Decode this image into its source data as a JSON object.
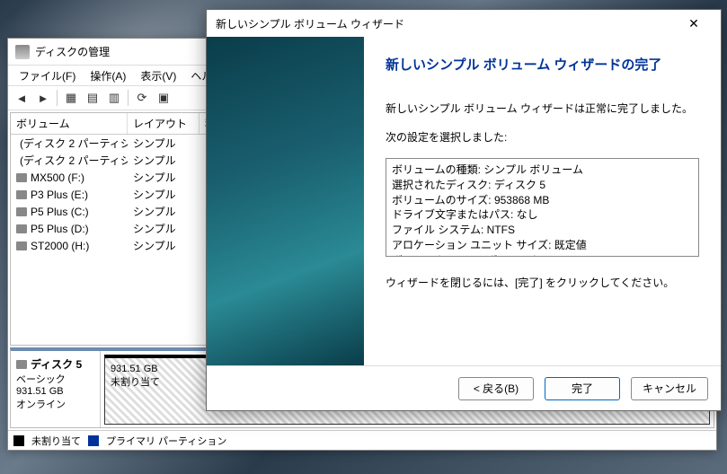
{
  "dm": {
    "title": "ディスクの管理",
    "menu": {
      "file": "ファイル(F)",
      "action": "操作(A)",
      "view": "表示(V)",
      "help": "ヘルプ"
    },
    "headers": {
      "volume": "ボリューム",
      "layout": "レイアウト",
      "rest": "種"
    },
    "volumes": [
      {
        "name": "(ディスク 2 パーティシ...",
        "layout": "シンプル"
      },
      {
        "name": "(ディスク 2 パーティシ...",
        "layout": "シンプル"
      },
      {
        "name": "MX500 (F:)",
        "layout": "シンプル"
      },
      {
        "name": "P3 Plus (E:)",
        "layout": "シンプル"
      },
      {
        "name": "P5 Plus (C:)",
        "layout": "シンプル"
      },
      {
        "name": "P5 Plus (D:)",
        "layout": "シンプル"
      },
      {
        "name": "ST2000 (H:)",
        "layout": "シンプル"
      }
    ],
    "disk": {
      "label": "ディスク 5",
      "type": "ベーシック",
      "size": "931.51 GB",
      "status": "オンライン",
      "part_size": "931.51 GB",
      "part_status": "未割り当て"
    },
    "legend": {
      "unalloc": "未割り当て",
      "primary": "プライマリ パーティション"
    }
  },
  "wizard": {
    "title": "新しいシンプル ボリューム ウィザード",
    "heading": "新しいシンプル ボリューム ウィザードの完了",
    "done_msg": "新しいシンプル ボリューム ウィザードは正常に完了しました。",
    "selected_label": "次の設定を選択しました:",
    "summary": [
      "ボリュームの種類: シンプル ボリューム",
      "選択されたディスク: ディスク 5",
      "ボリュームのサイズ: 953868 MB",
      "ドライブ文字またはパス: なし",
      "ファイル システム: NTFS",
      "アロケーション ユニット サイズ: 既定値",
      "ボリューム ラベル: ボリューム"
    ],
    "close_msg": "ウィザードを閉じるには、[完了] をクリックしてください。",
    "buttons": {
      "back": "< 戻る(B)",
      "finish": "完了",
      "cancel": "キャンセル"
    }
  }
}
